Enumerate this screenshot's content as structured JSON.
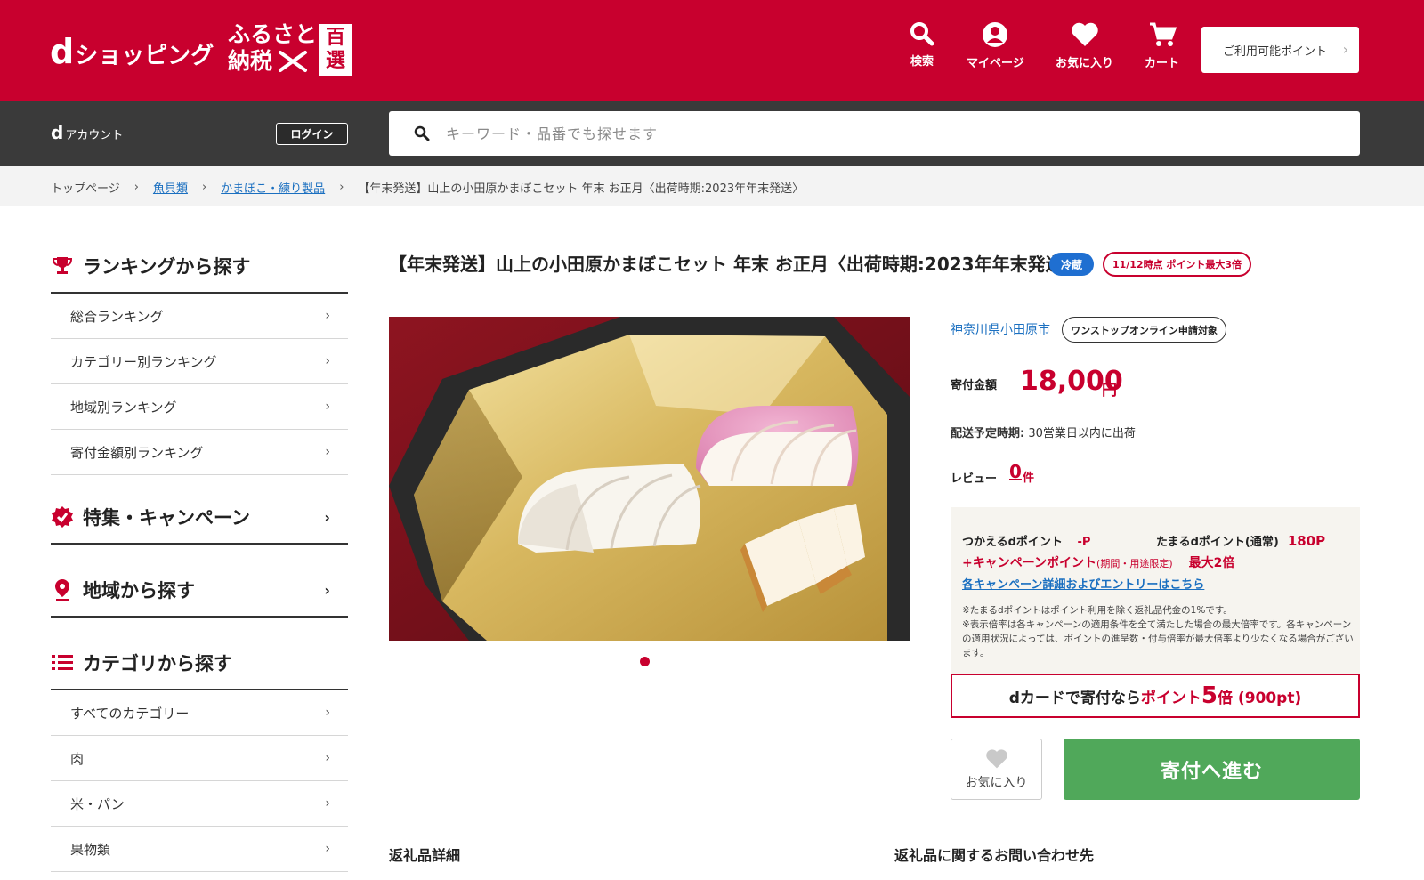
{
  "header": {
    "logo_d": "d",
    "logo_rest": "ショッピング",
    "furusato_line1": "ふるさと",
    "furusato_line2": "納税",
    "hyakusen_1": "百",
    "hyakusen_2": "選",
    "nav": [
      {
        "label": "検索",
        "icon": "search-icon"
      },
      {
        "label": "マイページ",
        "icon": "user-icon"
      },
      {
        "label": "お気に入り",
        "icon": "heart-icon"
      },
      {
        "label": "カート",
        "icon": "cart-icon"
      }
    ],
    "points_button": "ご利用可能ポイント"
  },
  "accountbar": {
    "d": "d",
    "account_label": "アカウント",
    "login_label": "ログイン",
    "search_placeholder": "キーワード・品番でも探せます"
  },
  "breadcrumb": {
    "items": [
      "トップページ",
      "魚貝類",
      "かまぼこ・練り製品",
      "【年末発送】山上の小田原かまぼこセット 年末 お正月〈出荷時期:2023年年末発送〉"
    ]
  },
  "sidebar": {
    "ranking_title": "ランキングから探す",
    "ranking_items": [
      "総合ランキング",
      "カテゴリー別ランキング",
      "地域別ランキング",
      "寄付金額別ランキング"
    ],
    "campaign_title": "特集・キャンペーン",
    "region_title": "地域から探す",
    "category_title": "カテゴリから探す",
    "category_items": [
      "すべてのカテゴリー",
      "肉",
      "米・パン",
      "果物類"
    ]
  },
  "product": {
    "title": "【年末発送】山上の小田原かまぼこセット 年末 お正月〈出荷時期:2023年年末発送〉",
    "badge_cold": "冷蔵",
    "badge_points": "11/12時点 ポイント最大3倍",
    "municipality": "神奈川県小田原市",
    "onestop": "ワンストップオンライン申請対象",
    "price_label": "寄付金額",
    "price_value": "18,000",
    "price_unit": "円",
    "ship_label": "配送予定時期:",
    "ship_value": " 30営業日以内に出荷",
    "review_label": "レビュー",
    "review_count": "0",
    "review_unit": "件"
  },
  "points": {
    "use_label": "つかえるdポイント",
    "use_value": "-P",
    "earn_label": "たまるdポイント(通常)",
    "earn_value": "180P",
    "campaign_label": "+キャンペーンポイント",
    "campaign_small": "(期間・用途限定)",
    "campaign_max": "最大2倍",
    "campaign_link": "各キャンペーン詳細およびエントリーはこちら",
    "note1": "※たまるdポイントはポイント利用を除く返礼品代金の1%です。",
    "note2": "※表示倍率は各キャンペーンの適用条件を全て満たした場合の最大倍率です。各キャンペーンの適用状況によっては、ポイントの進呈数・付与倍率が最大倍率より少なくなる場合がございます。",
    "dcard_pre": "dカードで寄付なら",
    "dcard_pt": "ポイント ",
    "dcard_num": "5",
    "dcard_post": "倍 (900pt)"
  },
  "actions": {
    "favorite": "お気に入り",
    "donate": "寄付へ進む"
  },
  "sections": {
    "detail": "返礼品詳細",
    "contact": "返礼品に関するお問い合わせ先"
  },
  "colors": {
    "brand_red": "#c8002e",
    "dark_bar": "#3a3a3a",
    "link_blue": "#1a6fc0",
    "donate_green": "#50a85a",
    "cold_badge_blue": "#1f6fd1"
  }
}
